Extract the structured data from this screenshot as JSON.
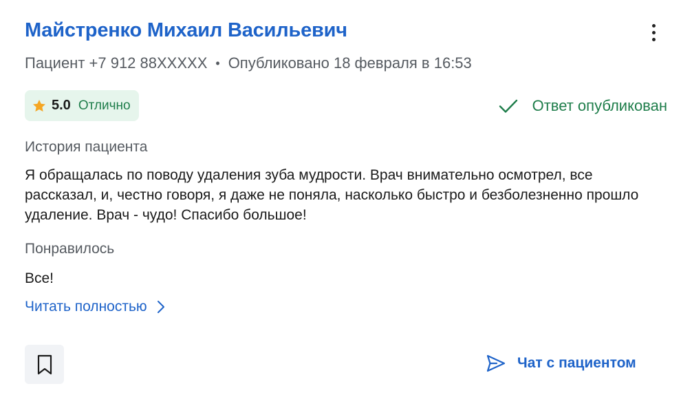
{
  "review": {
    "author_name": "Майстренко Михаил Васильевич",
    "meta": {
      "patient": "Пациент +7 912 88XXXXX",
      "separator": "•",
      "published": "Опубликовано 18 февраля в 16:53"
    },
    "rating": {
      "score": "5.0",
      "verdict": "Отлично"
    },
    "status": "Ответ опубликован",
    "history": {
      "label": "История пациента",
      "text": "Я обращалась по поводу удаления зуба мудрости. Врач внимательно осмотрел, все рассказал, и, честно говоря, я даже не поняла, насколько быстро и безболезненно прошло удаление. Врач - чудо! Спасибо большое!"
    },
    "liked": {
      "label": "Понравилось",
      "text": "Все!"
    },
    "read_more": "Читать полностью",
    "chat_button": "Чат с пациентом"
  },
  "icons": {
    "more": "more-vertical-icon",
    "star": "star-icon",
    "check": "check-icon",
    "chevron": "chevron-right-icon",
    "bookmark": "bookmark-icon",
    "send": "send-icon"
  },
  "colors": {
    "link_blue": "#1e63c9",
    "success_green": "#1e7d4a",
    "rating_bg": "#e6f5ec",
    "star": "#f5a623",
    "muted_text": "#555a60"
  }
}
